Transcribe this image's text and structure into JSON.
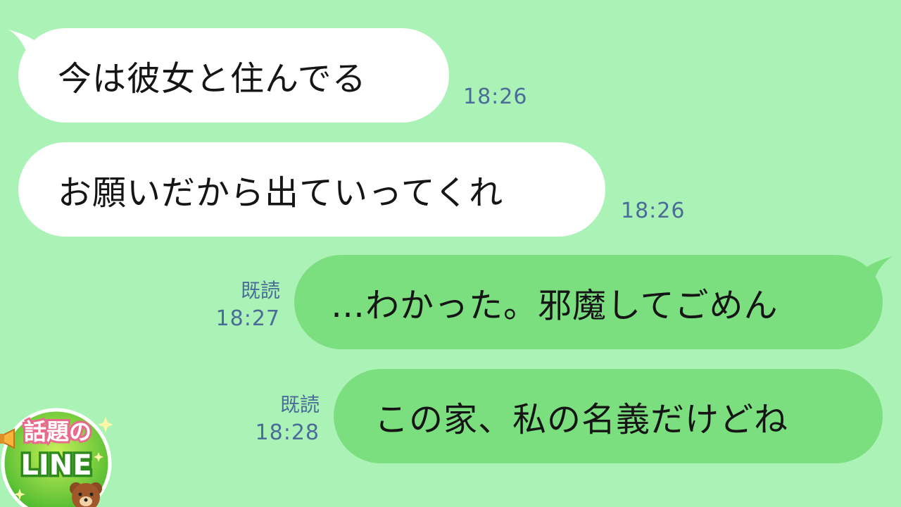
{
  "messages": [
    {
      "direction": "incoming",
      "text": "今は彼女と住んでる",
      "time": "18:26"
    },
    {
      "direction": "incoming",
      "text": "お願いだから出ていってくれ",
      "time": "18:26"
    },
    {
      "direction": "outgoing",
      "text": "…わかった。邪魔してごめん",
      "read": "既読",
      "time": "18:27"
    },
    {
      "direction": "outgoing",
      "text": "この家、私の名義だけどね",
      "read": "既読",
      "time": "18:28"
    }
  ],
  "logo": {
    "title": "話題の",
    "brand": "LINE"
  },
  "colors": {
    "background": "#abf2b7",
    "incoming_bubble": "#ffffff",
    "outgoing_bubble": "#7bde7f",
    "timestamp": "#4a6d98"
  }
}
